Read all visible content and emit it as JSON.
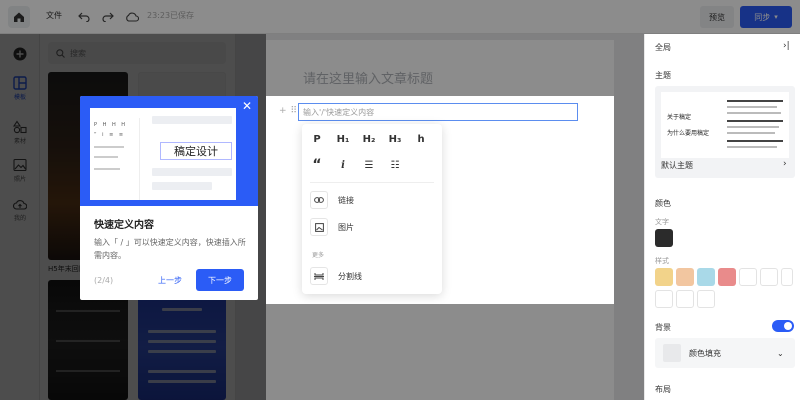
{
  "topbar": {
    "file_label": "文件",
    "saved_status": "23:23已保存",
    "preview_label": "预览",
    "sync_label": "同步"
  },
  "rail": {
    "items": [
      {
        "label": "",
        "icon": "plus-icon"
      },
      {
        "label": "模板",
        "icon": "template-icon"
      },
      {
        "label": "素材",
        "icon": "shapes-icon"
      },
      {
        "label": "照片",
        "icon": "image-icon"
      },
      {
        "label": "我的",
        "icon": "cloud-upload-icon"
      }
    ]
  },
  "left_panel": {
    "search_placeholder": "搜索",
    "thumb_caption": "H5年末回顾"
  },
  "editor": {
    "title_placeholder": "请在这里输入文章标题",
    "line_placeholder": "输入'/'快速定义内容"
  },
  "slash_menu": {
    "formats_row1": [
      "P",
      "H₁",
      "H₂",
      "H₃",
      "h"
    ],
    "formats_row2": [
      "“",
      "i",
      "☰",
      "☷"
    ],
    "items": [
      {
        "label": "链接",
        "icon": "link-icon"
      },
      {
        "label": "图片",
        "icon": "image-icon"
      }
    ],
    "more_label": "更多",
    "more_items": [
      {
        "label": "分割线",
        "icon": "divider-icon"
      }
    ]
  },
  "tour": {
    "hero_text": "稿定设计",
    "title": "快速定义内容",
    "description": "输入「 / 」可以快速定义内容，快速插入所需内容。",
    "step": "(2/4)",
    "prev_label": "上一步",
    "next_label": "下一步"
  },
  "right_panel": {
    "section_global": "全局",
    "section_theme": "主题",
    "theme_card_left_title1": "关于稿定",
    "theme_card_left_title2": "为什么要用稿定",
    "theme_name": "默认主题",
    "section_color": "颜色",
    "sub_text": "文字",
    "sub_style": "样式",
    "section_background": "背景",
    "background_fill": "颜色填充",
    "section_layout": "布局",
    "colors": {
      "accent": "#2b5cf6",
      "text_swatch": "#2b2b2b",
      "style_swatches": [
        "#f2d38a",
        "#f2c6a0",
        "#a9d9e8",
        "#e98b8b"
      ]
    }
  }
}
